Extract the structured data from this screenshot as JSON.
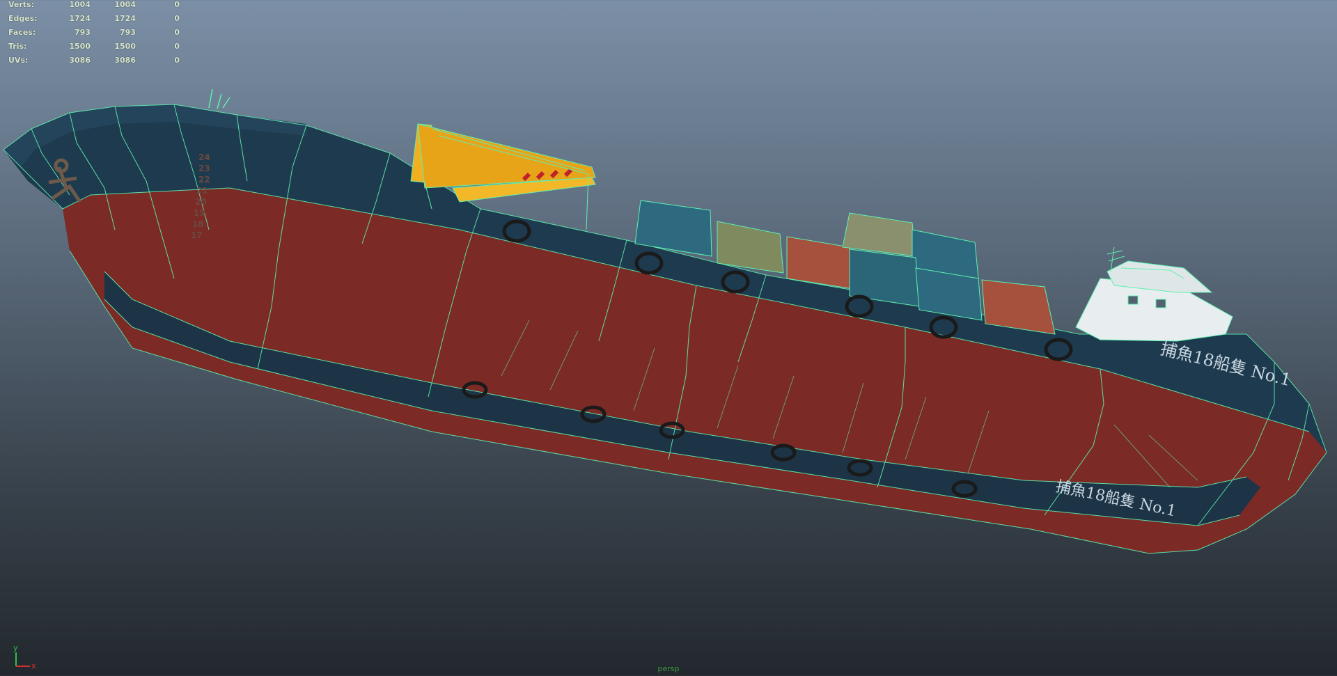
{
  "hud": {
    "stats": [
      {
        "label": "Verts:",
        "total": "1004",
        "selected": "1004",
        "other": "0"
      },
      {
        "label": "Edges:",
        "total": "1724",
        "selected": "1724",
        "other": "0"
      },
      {
        "label": "Faces:",
        "total": "793",
        "selected": "793",
        "other": "0"
      },
      {
        "label": "Tris:",
        "total": "1500",
        "selected": "1500",
        "other": "0"
      },
      {
        "label": "UVs:",
        "total": "3086",
        "selected": "3086",
        "other": "0"
      }
    ]
  },
  "viewport": {
    "camera_label": "persp",
    "axis": {
      "y": "y",
      "x": "x"
    },
    "hull_text": [
      "捕魚18船隻 No.1",
      "捕魚18船隻 No.1"
    ],
    "draft_marks": [
      "24",
      "23",
      "22",
      "21",
      "20",
      "19",
      "18",
      "17"
    ],
    "colors": {
      "wireframe": "#5ef0b0",
      "hull_top": "#1e3a4e",
      "hull_red": "#7c2a26",
      "deck": "#6f98a8",
      "crane": "#f0b020",
      "container_teal": "#2d6a80",
      "container_rust": "#a5513d",
      "container_olive": "#7f8a5e",
      "bridge": "#e8eef0"
    },
    "icons": [
      "anchor-icon",
      "tire-fender-icon",
      "antenna-icon"
    ]
  }
}
